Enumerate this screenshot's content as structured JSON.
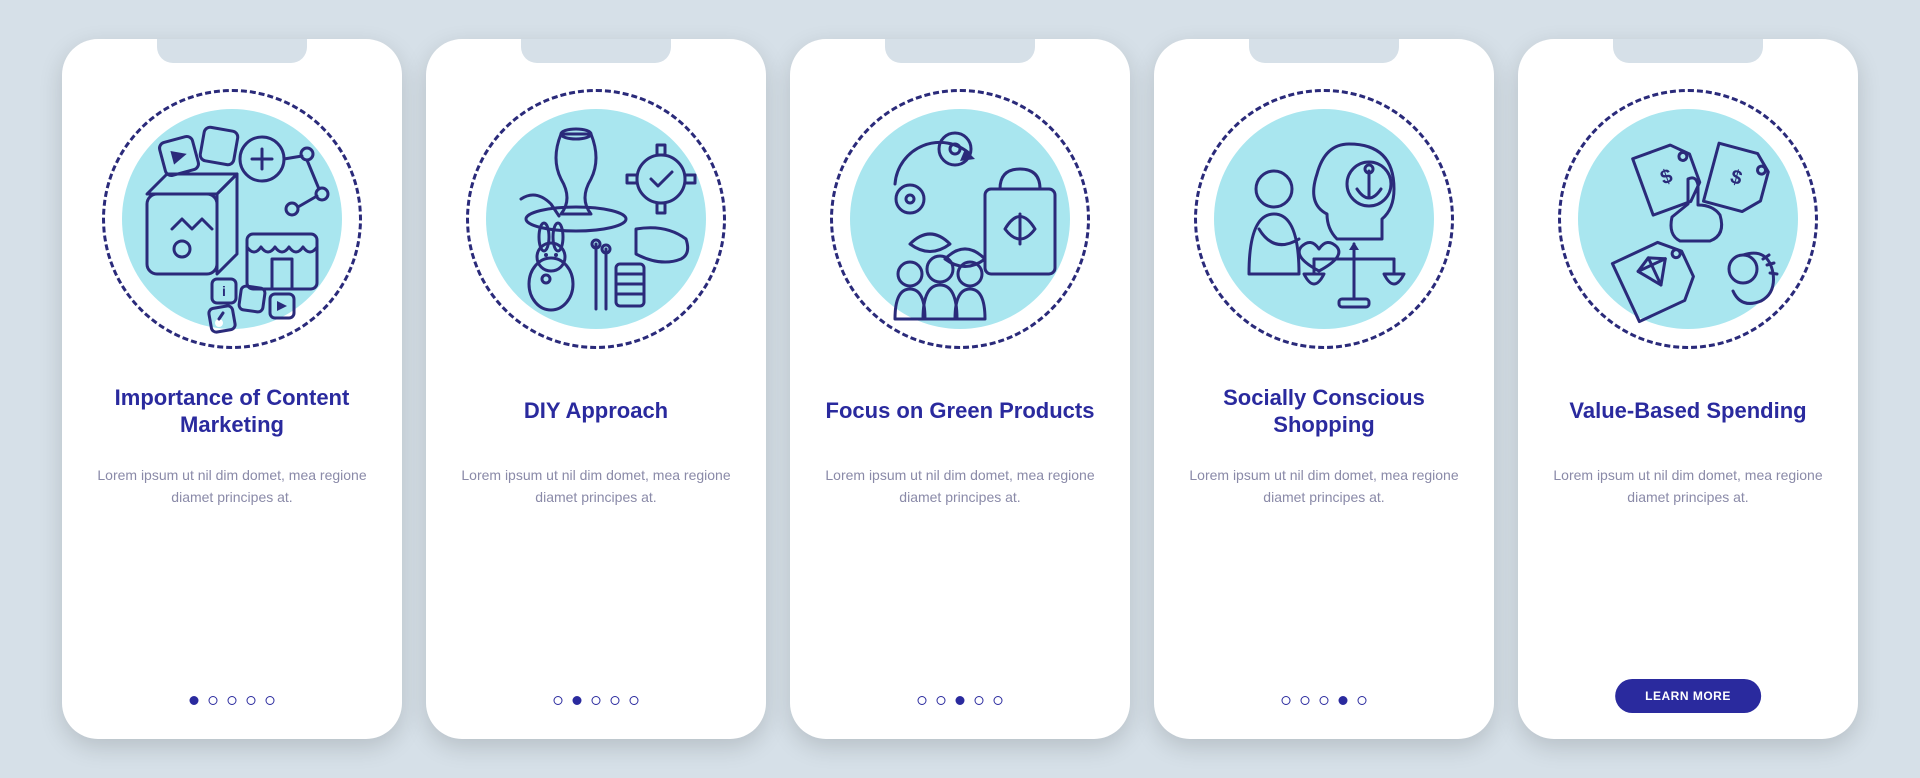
{
  "colors": {
    "background": "#d6e0e8",
    "card": "#ffffff",
    "heading": "#2a2a9e",
    "body": "#8a8aa8",
    "stroke": "#2a2a7a",
    "circle_fill": "#a9e6ef",
    "accent_red": "#ef7a7a",
    "accent_yellow": "#f7d95a",
    "accent_teal": "#5fd0c0",
    "cta_bg": "#2a2a9e"
  },
  "screens": [
    {
      "id": "content-marketing",
      "title": "Importance of Content Marketing",
      "body": "Lorem ipsum ut nil dim domet, mea regione diamet principes at.",
      "active_dot": 0,
      "has_cta": false
    },
    {
      "id": "diy-approach",
      "title": "DIY Approach",
      "body": "Lorem ipsum ut nil dim domet, mea regione diamet principes at.",
      "active_dot": 1,
      "has_cta": false
    },
    {
      "id": "green-products",
      "title": "Focus on Green Products",
      "body": "Lorem ipsum ut nil dim domet, mea regione diamet principes at.",
      "active_dot": 2,
      "has_cta": false
    },
    {
      "id": "socially-conscious",
      "title": "Socially Conscious Shopping",
      "body": "Lorem ipsum ut nil dim domet, mea regione diamet principes at.",
      "active_dot": 3,
      "has_cta": false
    },
    {
      "id": "value-based",
      "title": "Value-Based Spending",
      "body": "Lorem ipsum ut nil dim domet, mea regione diamet principes at.",
      "active_dot": 4,
      "has_cta": true,
      "cta_label": "LEARN MORE"
    }
  ],
  "dot_count": 5
}
